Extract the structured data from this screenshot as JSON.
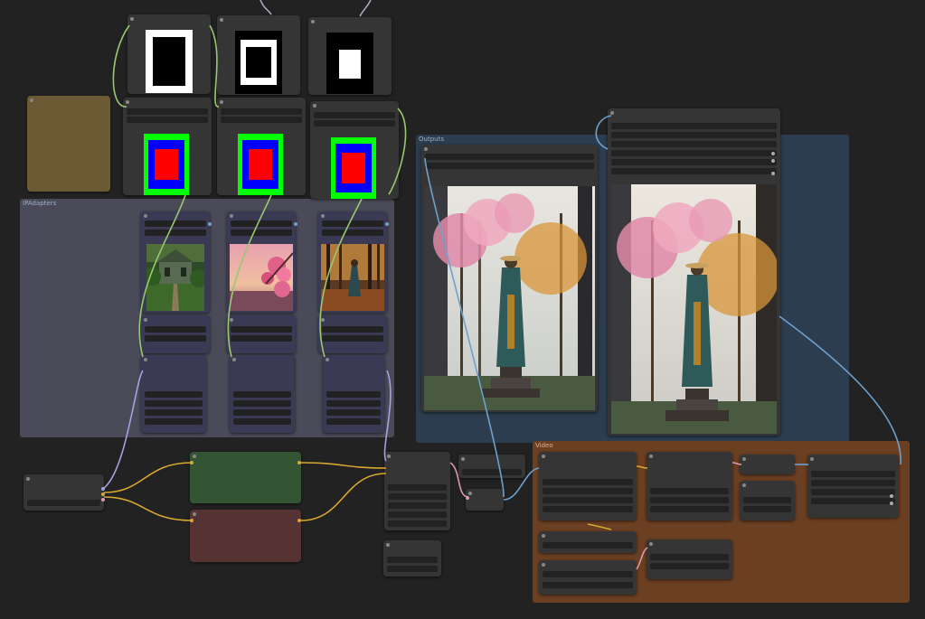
{
  "canvas": {
    "background": "#222222"
  },
  "groups": {
    "ipadapters": {
      "label": "IPAdapters",
      "color": "#4a4a58"
    },
    "outputs": {
      "label": "Outputs",
      "color": "#2b3d4f"
    },
    "video": {
      "label": "Video",
      "color": "#6b3f22"
    }
  },
  "mask_sources": [
    {
      "name": "mask-border-thick",
      "inner": "black",
      "frame": "white"
    },
    {
      "name": "mask-border-medium",
      "inner": "black",
      "frame": "white"
    },
    {
      "name": "mask-border-small",
      "inner": "white",
      "frame": "black"
    }
  ],
  "mask_previews": [
    {
      "outer": "#00ff00",
      "middle": "#0000ff",
      "inner": "#ff0000"
    },
    {
      "outer": "#00ff00",
      "middle": "#0000ff",
      "inner": "#ff0000"
    },
    {
      "outer": "#00ff00",
      "middle": "#0000ff",
      "inner": "#ff0000"
    }
  ],
  "reference_images": [
    {
      "subject": "overgrown ruined mansion in forest"
    },
    {
      "subject": "pink cherry blossoms at sunset"
    },
    {
      "subject": "robed figure walking in autumn forest"
    }
  ],
  "output_images": [
    {
      "subject": "cloaked figure on pedestal under cherry tree"
    },
    {
      "subject": "cloaked figure on pedestal under cherry tree"
    }
  ],
  "colors": {
    "node": "#353535",
    "widget": "#222222",
    "note": "#6b5a33",
    "positive": "#335533",
    "negative": "#553333",
    "ipadapter_node": "#3a3a55",
    "link_yellow": "#d8a830",
    "link_blue": "#6fa0cc",
    "link_green": "#9ac870",
    "link_pink": "#d89ab0",
    "link_purple": "#a8a0e0"
  }
}
